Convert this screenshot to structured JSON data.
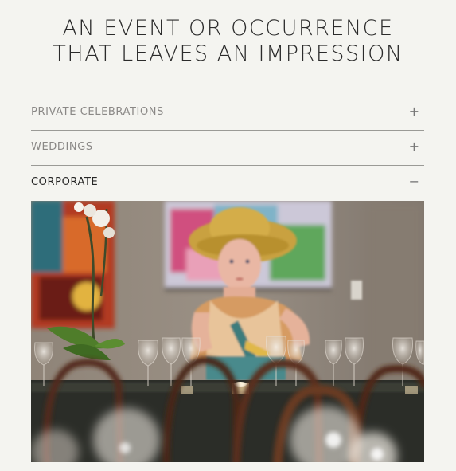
{
  "headline": {
    "line1": "AN EVENT OR OCCURRENCE",
    "line2": "THAT LEAVES AN IMPRESSION"
  },
  "accordion": {
    "items": [
      {
        "label": "PRIVATE CELEBRATIONS",
        "toggle": "+",
        "expanded": false
      },
      {
        "label": "WEDDINGS",
        "toggle": "+",
        "expanded": false
      },
      {
        "label": "CORPORATE",
        "toggle": "−",
        "expanded": true
      }
    ]
  },
  "colors": {
    "background": "#f4f4f0",
    "divider": "#9a9a96",
    "muted_label": "#8a8886",
    "active_label": "#262626"
  }
}
